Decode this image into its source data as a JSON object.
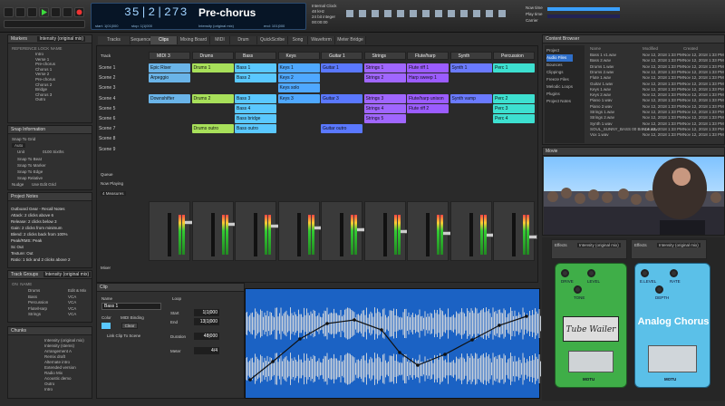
{
  "transport": {
    "counter": "35|2|273",
    "section": "Pre-chorus",
    "start": "start: 1|01|000",
    "stop": "stop: 1|1|000",
    "key": "end: 101|000",
    "tempo": "Intensity (original mix)",
    "cpu": "Internal Clock",
    "sample_rate": "48 kHz",
    "bit": "24 bit integer",
    "tc": "00:00:00",
    "now": "Now time",
    "play": "Play time",
    "carrier": "Carrier"
  },
  "markers": {
    "title": "Markers",
    "dropdown": "Intensity (original mix)",
    "cols": [
      "REFERENCE",
      "LOCK",
      "NAME",
      "TIME"
    ],
    "rows": [
      "Intro",
      "Verse 1",
      "Pre-chorus",
      "Chorus 1",
      "Verse 2",
      "Pre-chorus",
      "Chorus 2",
      "Bridge",
      "Chorus 3",
      "Outro"
    ]
  },
  "snap": {
    "title": "Snap Information",
    "snap_to": "Snap To Grid",
    "auto": "Auto",
    "unit": "Unit",
    "value": "0100 Sixths",
    "beat": "Snap To Beat",
    "marker": "Snap To Marker",
    "edge": "Snap To Edge",
    "relative": "Snap Relative",
    "nudge": "Nudge",
    "nudge_val": "Use Edit Grid"
  },
  "notes": {
    "title": "Project Notes",
    "lines": [
      "Outboard Gear - Recall Notes",
      "Attack: 2 clicks above 6",
      "Release: 2 clicks below 3",
      "Gain: 2 clicks from minimum",
      "Blend: 2 clicks back from 100%",
      "Peak/RMS: Peak",
      "Sc Out",
      "Texture: Out",
      "Ratio: 1 tick and 2 clicks above 2"
    ]
  },
  "trackgroups": {
    "title": "Track Groups",
    "dropdown": "Intensity (original mix)",
    "cols": [
      "ON",
      "NAME",
      "TYPE"
    ],
    "rows": [
      [
        "Drums",
        "Edit & Mix"
      ],
      [
        "Bass",
        "VCA"
      ],
      [
        "Percussion",
        "VCA"
      ],
      [
        "Flute/Harp",
        "VCA"
      ],
      [
        "Strings",
        "VCA"
      ]
    ]
  },
  "chunks": {
    "title": "Chunks",
    "rows": [
      "Intensity (original mix)",
      "Intensity (stems)",
      "Arrangement A",
      "Remix draft",
      "Alternate intro",
      "Extended version",
      "Radio Mix",
      "Acoustic demo",
      "Outro",
      "Intro"
    ]
  },
  "tabs": [
    "Tracks",
    "Sequence",
    "Clips",
    "Mixing Board",
    "MIDI",
    "Drum",
    "QuickScribe",
    "Song",
    "Waveform",
    "Meter Bridge"
  ],
  "tracks": [
    "MIDI 3",
    "Drums",
    "Bass",
    "Keys",
    "Guitar 1",
    "Strings",
    "Flute/harp",
    "Synth",
    "Percussion"
  ],
  "scenes": [
    "Scene 1",
    "Scene 2",
    "Scene 3",
    "Scene 4",
    "Scene 5",
    "Scene 6",
    "Scene 7",
    "Scene 8",
    "Scene 9"
  ],
  "clips": [
    [
      0,
      0,
      "Epic Riser",
      "#6ab4e8"
    ],
    [
      1,
      0,
      "Drums 1",
      "#a8e05a"
    ],
    [
      2,
      0,
      "Bass 1",
      "#5ac8ff"
    ],
    [
      3,
      0,
      "Keys 1",
      "#4fa8ff"
    ],
    [
      4,
      0,
      "Guitar 1",
      "#5a78ff"
    ],
    [
      5,
      0,
      "Strings 1",
      "#a066ff"
    ],
    [
      6,
      0,
      "Flute riff 1",
      "#9b5cff"
    ],
    [
      7,
      0,
      "Synth 1",
      "#6a7aff"
    ],
    [
      8,
      0,
      "Perc 1",
      "#3de0d0"
    ],
    [
      0,
      1,
      "Arpeggio",
      "#6ab4e8"
    ],
    [
      2,
      1,
      "Bass 2",
      "#5ac8ff"
    ],
    [
      3,
      1,
      "Keys 2",
      "#4fa8ff"
    ],
    [
      5,
      1,
      "Strings 2",
      "#a066ff"
    ],
    [
      6,
      1,
      "Harp sweep 1",
      "#9b5cff"
    ],
    [
      3,
      2,
      "Keys solo",
      "#4fa8ff"
    ],
    [
      0,
      3,
      "Downshifter",
      "#6ab4e8"
    ],
    [
      1,
      3,
      "Drums 2",
      "#a8e05a"
    ],
    [
      2,
      3,
      "Bass 3",
      "#5ac8ff"
    ],
    [
      3,
      3,
      "Keys 3",
      "#4fa8ff"
    ],
    [
      4,
      3,
      "Guitar 3",
      "#5a78ff"
    ],
    [
      5,
      3,
      "Strings 3",
      "#a066ff"
    ],
    [
      6,
      3,
      "Flute/harp unison",
      "#9b5cff"
    ],
    [
      7,
      3,
      "Synth vamp",
      "#6a7aff"
    ],
    [
      8,
      3,
      "Perc 2",
      "#3de0d0"
    ],
    [
      2,
      4,
      "Bass 4",
      "#5ac8ff"
    ],
    [
      5,
      4,
      "Strings 4",
      "#a066ff"
    ],
    [
      6,
      4,
      "Flute riff 2",
      "#9b5cff"
    ],
    [
      8,
      4,
      "Perc 3",
      "#3de0d0"
    ],
    [
      2,
      5,
      "Bass bridge",
      "#5ac8ff"
    ],
    [
      5,
      5,
      "Strings 5",
      "#a066ff"
    ],
    [
      8,
      5,
      "Perc 4",
      "#3de0d0"
    ],
    [
      1,
      6,
      "Drums outro",
      "#a8e05a"
    ],
    [
      2,
      6,
      "Bass outro",
      "#5ac8ff"
    ],
    [
      4,
      6,
      "Guitar outro",
      "#5a78ff"
    ]
  ],
  "queue": {
    "queue": "Queue",
    "now": "Now Playing",
    "len": "4 Measures"
  },
  "mixer": "Mixer",
  "clip_editor": {
    "title": "Clip",
    "name_lbl": "Name",
    "name": "Bass 1",
    "color": "Color",
    "midi": "MIDI Binding",
    "clear": "Clear",
    "link": "Link Clip To Scene",
    "loop": "Loop",
    "start": "Start",
    "start_v": "1|1|000",
    "end": "End",
    "end_v": "13|1|000",
    "duration": "Duration",
    "dur_v": "48|000",
    "meter": "Meter",
    "meter_v": "4/4"
  },
  "browser": {
    "title": "Content Browser",
    "cols": [
      "Name",
      "Modified",
      "Created"
    ],
    "items": [
      "Project",
      "Audio Files",
      "Bounces",
      "Clippings",
      "Freeze Files",
      "Melodic Loops",
      "Plugins",
      "Project Notes"
    ],
    "files": [
      "Bass 1 v1.wav",
      "Bass 2.wav",
      "Drums 1.wav",
      "Drums 2.wav",
      "Flute 1.wav",
      "Guitar 1.wav",
      "Keys 1.wav",
      "Keys 2.wav",
      "Piano 1.wav",
      "Piano 2.wav",
      "Strings 1.wav",
      "Strings 2.wav",
      "Synth 1.wav",
      "SOUL_SUNNY_BASS 00 Bm 14.wav",
      "Vox 1.wav"
    ],
    "date": "Nov 12, 2018 1:33 PM"
  },
  "movie": {
    "title": "Movie"
  },
  "pedals": {
    "left": "Tube Wailer",
    "right": "Analog Chorus",
    "brand": "MOTU",
    "effects": "Effects",
    "preset": "Intensity (original mix)",
    "knobs_l": [
      "DRIVE",
      "LEVEL",
      "TONE"
    ],
    "knobs_r": [
      "E.LEVEL",
      "RATE",
      "DEPTH"
    ]
  },
  "colors": {
    "accent": "#3aa0ff",
    "chorus_pedal": "#5bc0e8",
    "tube_pedal": "#3fae48"
  }
}
